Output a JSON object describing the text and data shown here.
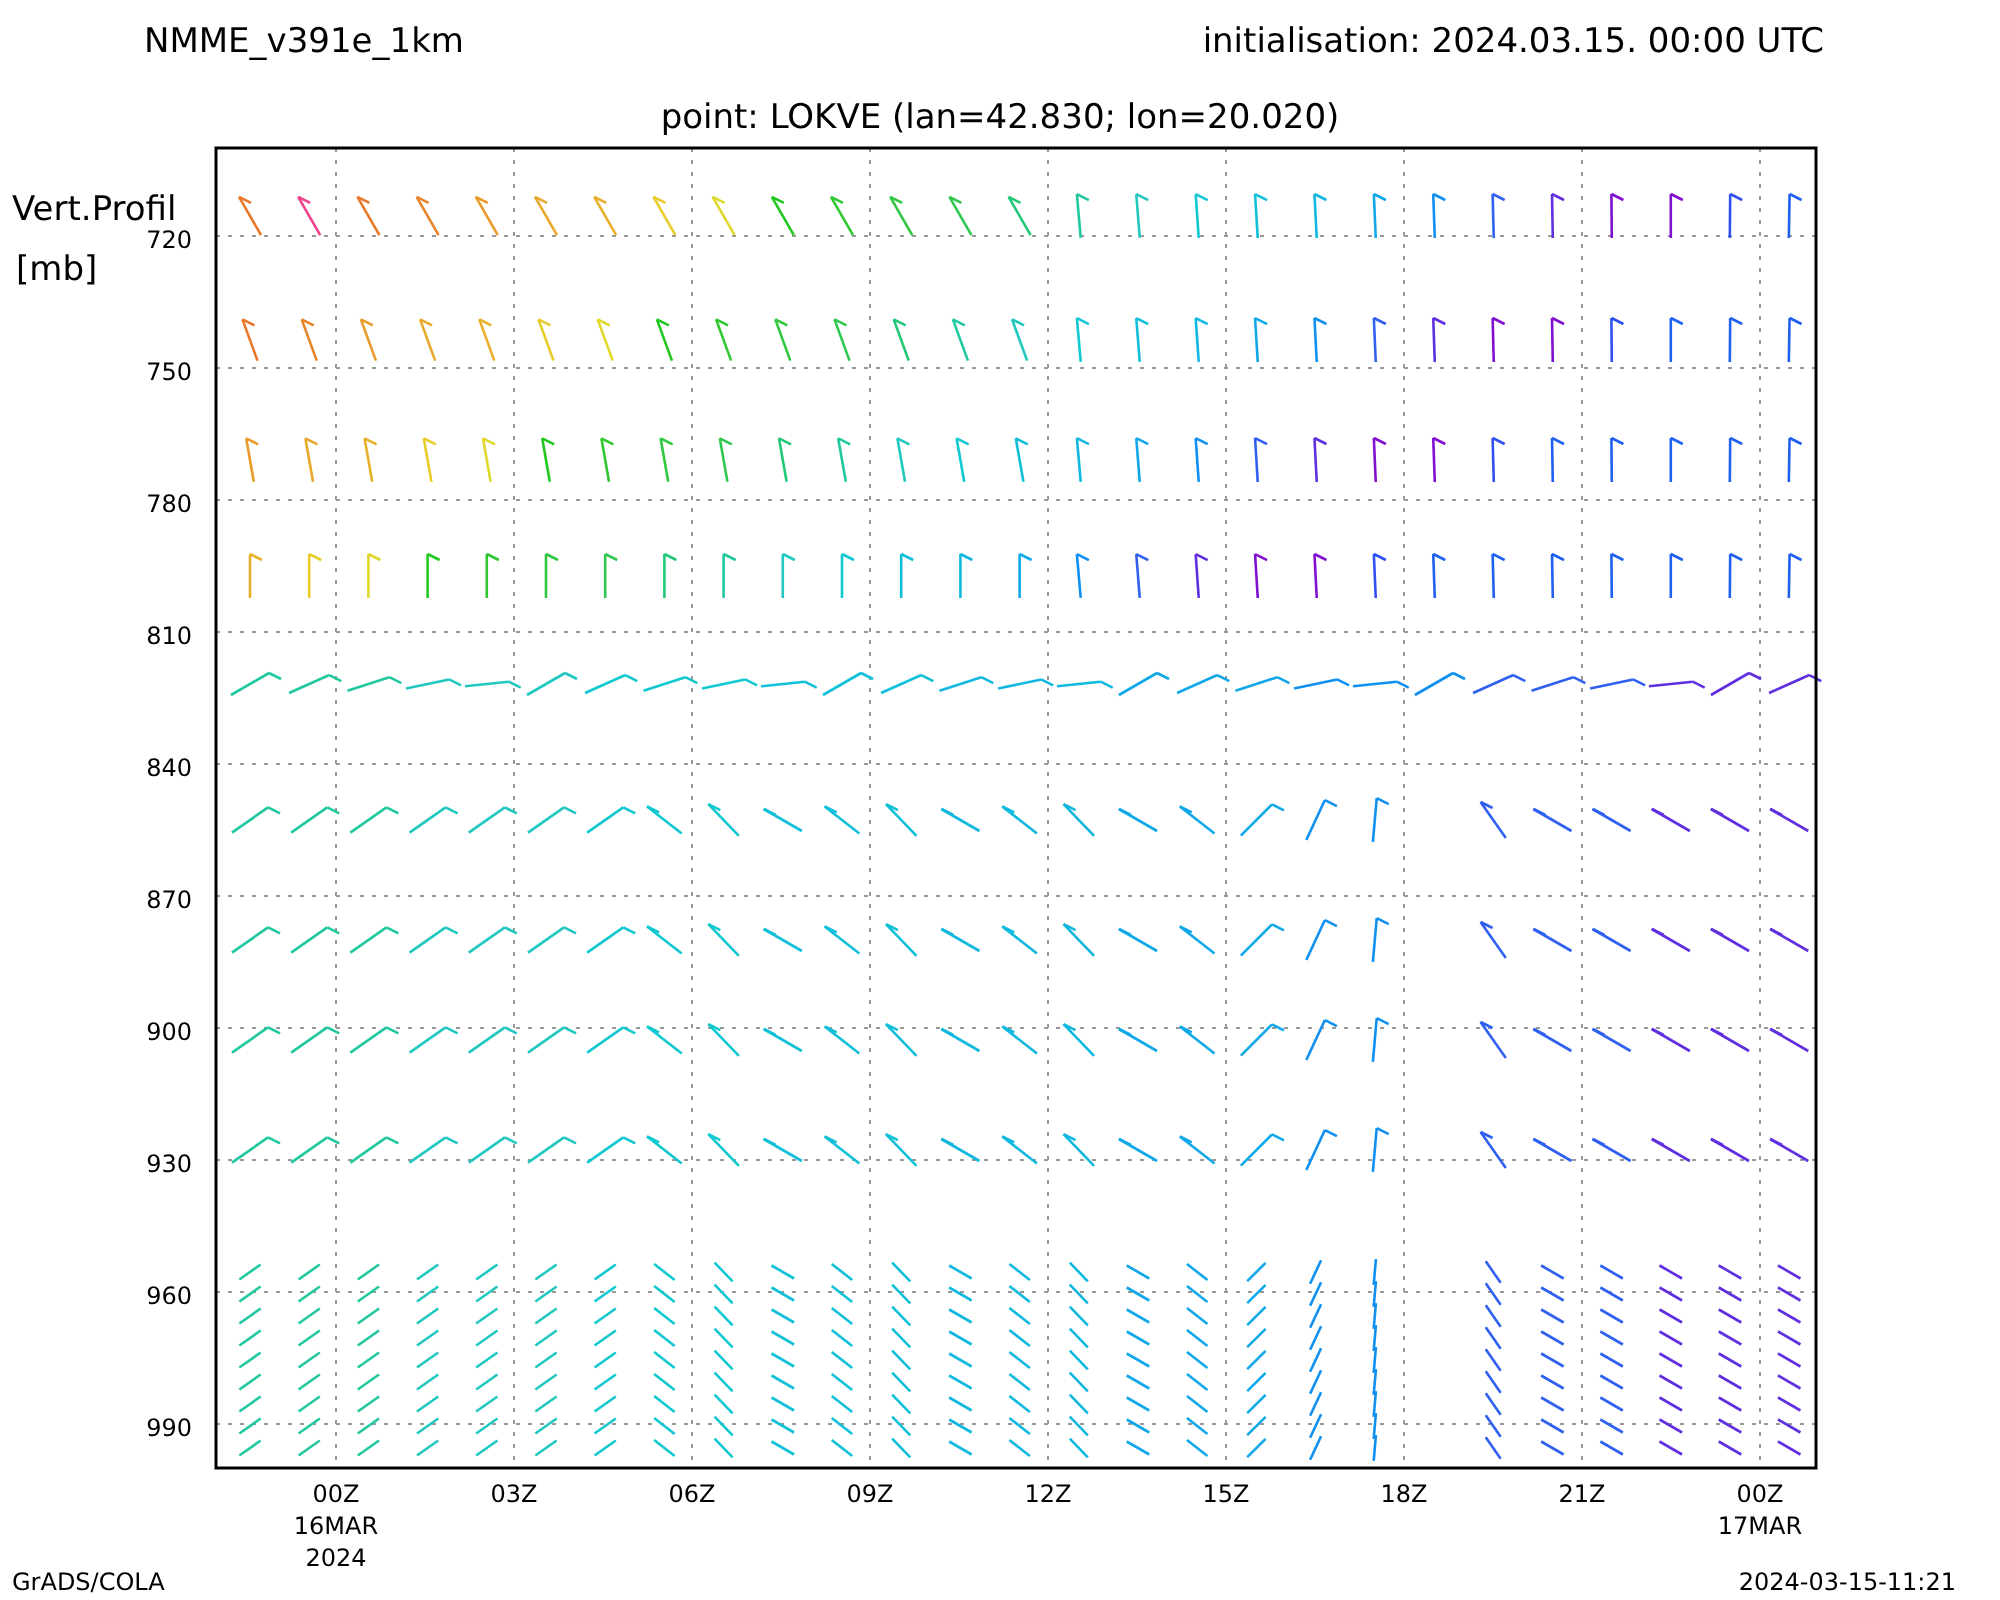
{
  "header": {
    "model": "NMME_v391e_1km",
    "initialisation": "initialisation: 2024.03.15. 00:00 UTC"
  },
  "plot": {
    "title": "point: LOKVE (lan=42.830; lon=20.020)",
    "y_label": [
      "Vert.Profil",
      "[mb]"
    ],
    "y_ticks": [
      "720",
      "750",
      "780",
      "810",
      "840",
      "870",
      "900",
      "930",
      "960",
      "990"
    ],
    "x_ticks": [
      {
        "label": "00Z",
        "sub": [
          "16MAR",
          "2024"
        ]
      },
      {
        "label": "03Z"
      },
      {
        "label": "06Z"
      },
      {
        "label": "09Z"
      },
      {
        "label": "12Z"
      },
      {
        "label": "15Z"
      },
      {
        "label": "18Z"
      },
      {
        "label": "21Z"
      },
      {
        "label": "00Z",
        "sub": [
          "17MAR"
        ]
      }
    ]
  },
  "footer": {
    "left": "GrADS/COLA",
    "right": "2024-03-15-11:21"
  }
}
